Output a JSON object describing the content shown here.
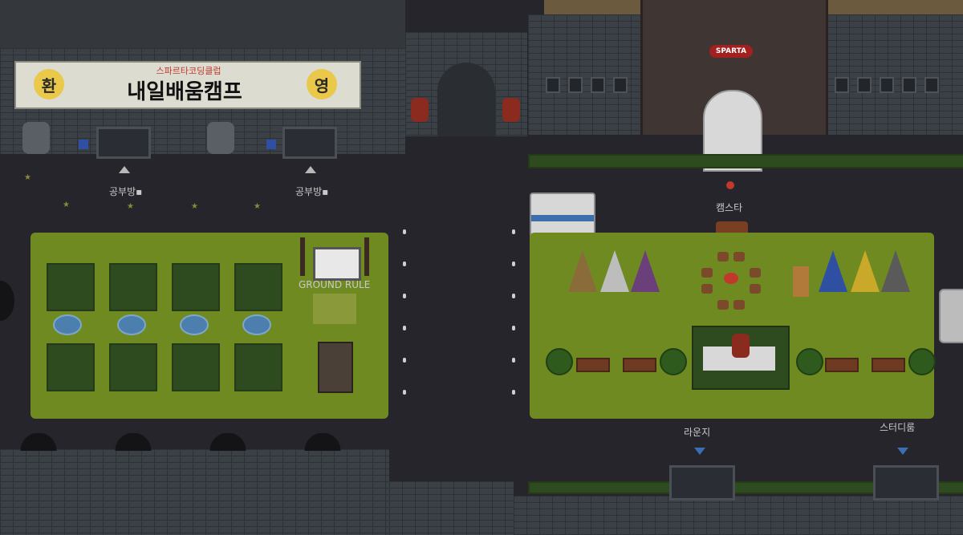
{
  "banner": {
    "left_char": "환",
    "right_char": "영",
    "subtitle": "스파르타코딩클럽",
    "title": "내일배움캠프"
  },
  "labels": {
    "study_room_1": "공부방",
    "study_room_2": "공부방",
    "ground_rule": "GROUND RULE",
    "camsta": "캠스타",
    "lounge": "라운지",
    "study_room_east": "스터디룸",
    "sparta_sign": "SPARTA"
  },
  "icons": {
    "study_room_icon": "laptop-icon",
    "up_arrow": "arrow-up-icon",
    "down_arrow": "arrow-down-icon"
  },
  "colors": {
    "lawn": "#6f8a20",
    "banner_bg": "#dcdcd0",
    "banner_circle": "#e9c84a",
    "camsta_marker": "#c0392b",
    "arrow_blue": "#3c6fb0"
  }
}
